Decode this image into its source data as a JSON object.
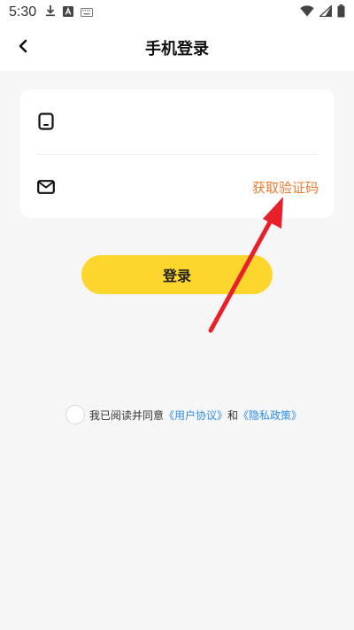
{
  "status_bar": {
    "time": "5:30",
    "left_icons": [
      "download-icon",
      "a-box-icon",
      "keyboard-icon"
    ],
    "right_icons": [
      "wifi-icon",
      "signal-icon",
      "battery-icon"
    ]
  },
  "header": {
    "title": "手机登录",
    "back_icon": "chevron-left-icon"
  },
  "form": {
    "phone": {
      "icon": "phone-icon",
      "value": "",
      "placeholder": ""
    },
    "code": {
      "icon": "mail-icon",
      "value": "",
      "placeholder": ""
    },
    "get_code_label": "获取验证码",
    "get_code_color": "#ec7a2e"
  },
  "login_button": {
    "label": "登录",
    "color": "#fdd62d"
  },
  "agreement": {
    "prefix": "我已阅读并同意",
    "user_agreement": "《用户协议》",
    "and": "和",
    "privacy_policy": "《隐私政策》",
    "link_color": "#2e8ee8",
    "checked": false
  },
  "annotation": {
    "arrow_color": "#e8202a"
  }
}
